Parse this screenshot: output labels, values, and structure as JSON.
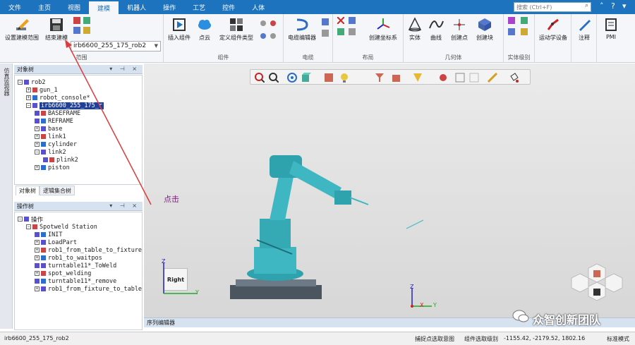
{
  "menubar": {
    "tabs": [
      "文件",
      "主页",
      "视图",
      "建模",
      "机器人",
      "操作",
      "工艺",
      "控件",
      "人体"
    ],
    "active_tab": "建模",
    "search_placeholder": "搜索 (Ctrl+F)"
  },
  "ribbon": {
    "set_scope_label": "设置建模范围",
    "end_modeling_label": "结束建模",
    "robot_combo_value": "irb6600_255_175_rob2",
    "group_scope": "范围",
    "insert_component_label": "插入组件",
    "point_cloud_label": "点云",
    "define_component_type_label": "定义组件类型",
    "group_component": "组件",
    "cable_editor_label": "电缆编辑器",
    "group_cable": "电缆",
    "create_frame_label": "创建坐标系",
    "group_layout": "布局",
    "solid_label": "实体",
    "curve_label": "曲线",
    "create_point_label": "创建点",
    "create_block_label": "创建块",
    "group_geometry": "几何体",
    "group_entity_level": "实体级别",
    "kinematics_label": "运动学设备",
    "annotation_label": "注释",
    "pmi_label": "PMI"
  },
  "side_strip": {
    "label": "仿真监视器"
  },
  "object_tree": {
    "title": "对象树",
    "rows": [
      {
        "indent": 0,
        "toggle": "−",
        "label": "rob2",
        "selected": false
      },
      {
        "indent": 1,
        "toggle": "+",
        "label": "gun_1",
        "selected": false
      },
      {
        "indent": 1,
        "toggle": "+",
        "label": "robot_console*",
        "selected": false
      },
      {
        "indent": 1,
        "toggle": "−",
        "label": "irb6600_255_175_r",
        "selected": true
      },
      {
        "indent": 2,
        "toggle": "",
        "label": "BASEFRAME",
        "selected": false
      },
      {
        "indent": 2,
        "toggle": "",
        "label": "REFRAME",
        "selected": false
      },
      {
        "indent": 2,
        "toggle": "+",
        "label": "base",
        "selected": false
      },
      {
        "indent": 2,
        "toggle": "+",
        "label": "link1",
        "selected": false
      },
      {
        "indent": 2,
        "toggle": "+",
        "label": "cylinder",
        "selected": false
      },
      {
        "indent": 2,
        "toggle": "−",
        "label": "link2",
        "selected": false
      },
      {
        "indent": 3,
        "toggle": "",
        "label": "plink2",
        "selected": false
      },
      {
        "indent": 2,
        "toggle": "+",
        "label": "piston",
        "selected": false
      }
    ],
    "tabs": [
      "对象树",
      "逻辑集合树"
    ]
  },
  "operation_tree": {
    "title": "操作树",
    "rows": [
      {
        "indent": 0,
        "toggle": "−",
        "label": "操作"
      },
      {
        "indent": 1,
        "toggle": "−",
        "label": "Spotweld Station"
      },
      {
        "indent": 2,
        "toggle": "",
        "label": "INIT"
      },
      {
        "indent": 2,
        "toggle": "+",
        "label": "LoadPart"
      },
      {
        "indent": 2,
        "toggle": "+",
        "label": "rob1_from_table_to_fixture"
      },
      {
        "indent": 2,
        "toggle": "+",
        "label": "rob1_to_waitpos"
      },
      {
        "indent": 2,
        "toggle": "",
        "label": "turntable11*_ToWeld"
      },
      {
        "indent": 2,
        "toggle": "+",
        "label": "spot_welding"
      },
      {
        "indent": 2,
        "toggle": "",
        "label": "turntable11*_remove"
      },
      {
        "indent": 2,
        "toggle": "+",
        "label": "rob1_from_fixture_to_table"
      }
    ]
  },
  "viewport": {
    "view_cube_label": "Right",
    "axis_z": "Z",
    "axis_y": "Y",
    "axis_x": "X"
  },
  "annotation": {
    "text": "点击"
  },
  "sequence_editor": {
    "title": "序列编辑器"
  },
  "statusbar": {
    "left": "irb6600_255_175_rob2",
    "snap": "捕捉点选取意图",
    "level": "组件选取级别",
    "coords": "-1155.42, -2179.52, 1802.16",
    "mode": "标准模式"
  },
  "watermark": {
    "text": "众智创新团队"
  },
  "colors": {
    "menubar": "#1e73be",
    "robot": "#3fb7c2",
    "selection": "#1f3f9c",
    "arrow": "#e03a3a"
  }
}
